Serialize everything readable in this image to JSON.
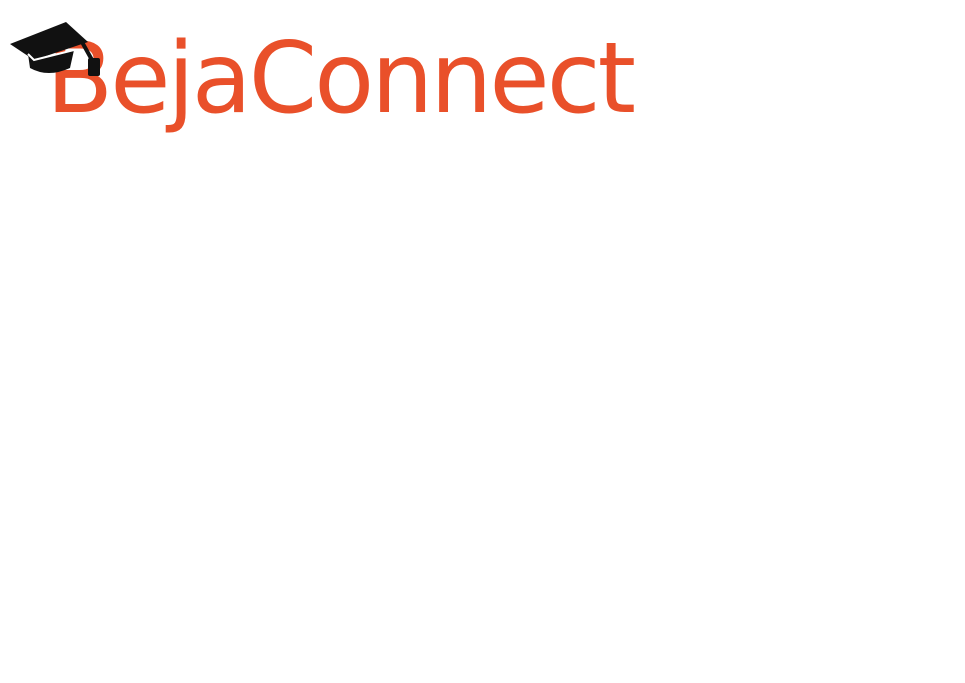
{
  "brand": {
    "name": "BejaConnect",
    "color": "#E9502A",
    "icon": "graduation-cap-icon"
  }
}
